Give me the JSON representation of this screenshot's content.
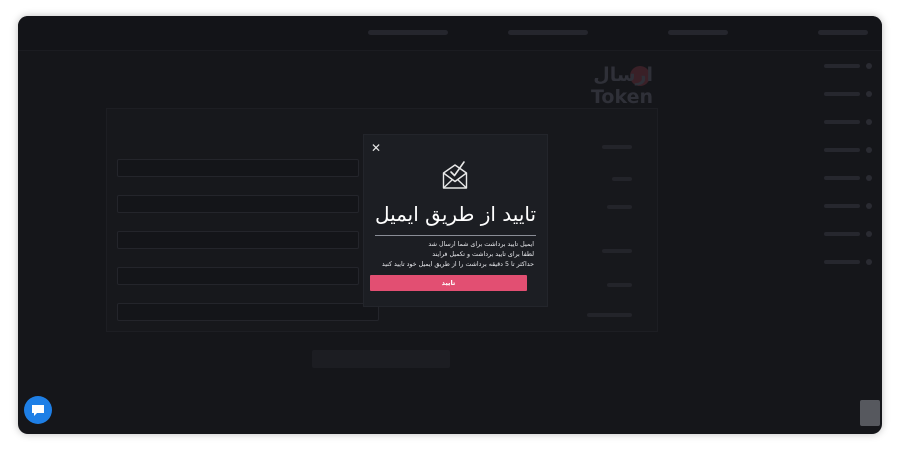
{
  "background_app": {
    "page_title": "ارسال Token"
  },
  "modal": {
    "close_symbol": "✕",
    "title": "تایید از طریق ایمیل",
    "lines": [
      "ایمیل تایید برداشت برای شما ارسال شد",
      "لطفا برای تایید برداشت و تکمیل فرایند",
      "حداکثر تا 5 دقیقه برداشت را از طریق ایمیل خود تایید کنید"
    ],
    "confirm_label": "تایید",
    "icon": "mail-check-icon"
  },
  "colors": {
    "accent": "#e24f72",
    "chat": "#1e7fe6",
    "backdrop": "#15161a"
  },
  "chat_widget": {
    "icon": "chat-bubble-icon"
  }
}
